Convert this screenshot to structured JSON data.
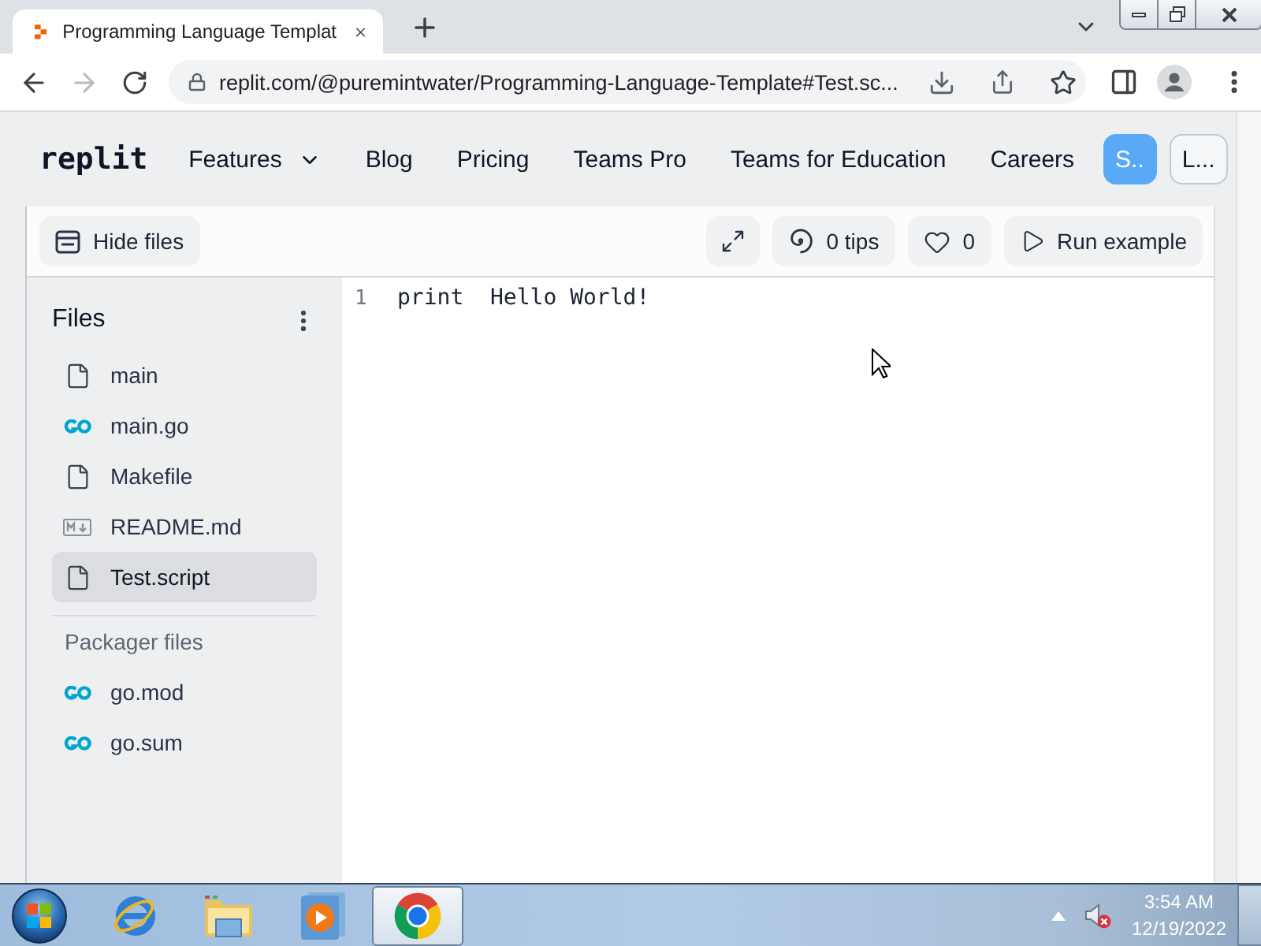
{
  "browser": {
    "tabs": [
      {
        "title": "Programming Language Templat",
        "selected": true
      }
    ],
    "address": "replit.com/@puremintwater/Programming-Language-Template#Test.sc..."
  },
  "site_nav": {
    "brand": "replit",
    "items": [
      {
        "label": "Features",
        "kind": "dropdown"
      },
      {
        "label": "Blog",
        "kind": "link"
      },
      {
        "label": "Pricing",
        "kind": "link"
      },
      {
        "label": "Teams Pro",
        "kind": "link"
      },
      {
        "label": "Teams for Education",
        "kind": "link"
      },
      {
        "label": "Careers",
        "kind": "link"
      }
    ],
    "buttons": [
      {
        "label": "S..",
        "kind": "primary"
      },
      {
        "label": "L...",
        "kind": "secondary"
      }
    ]
  },
  "toolbar": {
    "hide_files": "Hide files",
    "tips": "0 tips",
    "likes": "0",
    "run": "Run example"
  },
  "files": {
    "title": "Files",
    "items": [
      {
        "name": "main",
        "kind": "file",
        "selected": false
      },
      {
        "name": "main.go",
        "kind": "go",
        "selected": false
      },
      {
        "name": "Makefile",
        "kind": "file",
        "selected": false
      },
      {
        "name": "README.md",
        "kind": "markdown",
        "selected": false
      },
      {
        "name": "Test.script",
        "kind": "file",
        "selected": true
      }
    ],
    "packager_title": "Packager files",
    "packager_items": [
      {
        "name": "go.mod",
        "kind": "go",
        "selected": false
      },
      {
        "name": "go.sum",
        "kind": "go",
        "selected": false
      }
    ]
  },
  "editor": {
    "lines": [
      {
        "number": "1",
        "code": "print  Hello World!"
      }
    ]
  },
  "taskbar": {
    "apps": [
      {
        "kind": "ie",
        "selected": false
      },
      {
        "kind": "explorer",
        "selected": false
      },
      {
        "kind": "media",
        "selected": false
      },
      {
        "kind": "chrome",
        "selected": true
      }
    ],
    "time": "3:54 AM",
    "date": "12/19/2022"
  }
}
